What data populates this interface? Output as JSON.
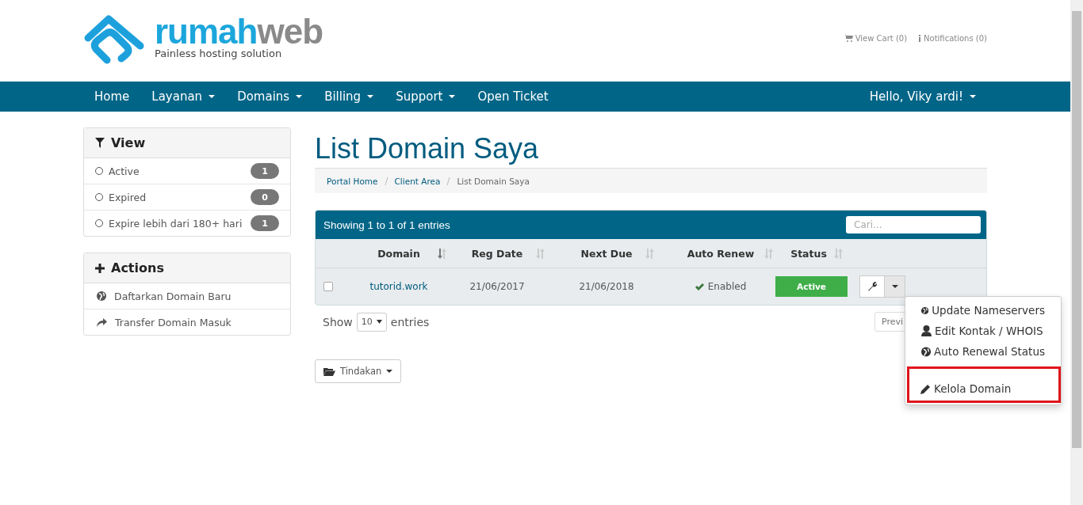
{
  "logo": {
    "brand_primary": "rumah",
    "brand_secondary": "web",
    "tagline": "Painless hosting solution"
  },
  "top_links": [
    {
      "kind": "cart",
      "label": "View Cart (0)"
    },
    {
      "kind": "info",
      "label": "Notifications (0)"
    }
  ],
  "nav": {
    "items": [
      {
        "label": "Home",
        "has_dropdown": false
      },
      {
        "label": "Layanan",
        "has_dropdown": true
      },
      {
        "label": "Domains",
        "has_dropdown": true
      },
      {
        "label": "Billing",
        "has_dropdown": true
      },
      {
        "label": "Support",
        "has_dropdown": true
      },
      {
        "label": "Open Ticket",
        "has_dropdown": false
      }
    ],
    "user": {
      "label": "Hello, Viky ardi!",
      "has_dropdown": true
    }
  },
  "sidebar": {
    "view": {
      "title": "View",
      "items": [
        {
          "label": "Active",
          "count": "1",
          "selected": false
        },
        {
          "label": "Expired",
          "count": "0",
          "selected": false
        },
        {
          "label": "Expire lebih dari 180+ hari",
          "count": "1",
          "selected": false
        }
      ]
    },
    "actions": {
      "title": "Actions",
      "items": [
        {
          "kind": "globe",
          "label": "Daftarkan Domain Baru"
        },
        {
          "kind": "share",
          "label": "Transfer Domain Masuk"
        }
      ]
    }
  },
  "page_title": "List Domain Saya",
  "breadcrumb": [
    "Portal Home",
    "Client Area",
    "List Domain Saya"
  ],
  "table": {
    "info": "Showing 1 to 1 of 1 entries",
    "search": {
      "placeholder": "Cari..."
    },
    "columns": [
      {
        "label": "Domain",
        "sorted": true
      },
      {
        "label": "Reg Date",
        "sorted": false
      },
      {
        "label": "Next Due",
        "sorted": false
      },
      {
        "label": "Auto Renew",
        "sorted": false
      },
      {
        "label": "Status",
        "sorted": false
      }
    ],
    "rows": [
      {
        "checked": false,
        "domain": "tutorid.work",
        "reg_date": "21/06/2017",
        "next_due": "21/06/2018",
        "auto_renew": "Enabled",
        "auto_renew_on": true,
        "status": "Active"
      }
    ],
    "length": {
      "prefix": "Show",
      "value": "10",
      "suffix": "entries"
    },
    "pagination_partial": "Previ"
  },
  "actions_button": "Tindakan",
  "row_menu": {
    "items": [
      {
        "kind": "globe",
        "label": "Update Nameservers",
        "highlighted": false
      },
      {
        "kind": "user",
        "label": "Edit Kontak / WHOIS",
        "highlighted": false
      },
      {
        "kind": "globe",
        "label": "Auto Renewal Status",
        "highlighted": false
      },
      {
        "kind": "pencil",
        "label": "Kelola Domain",
        "highlighted": true
      }
    ]
  }
}
